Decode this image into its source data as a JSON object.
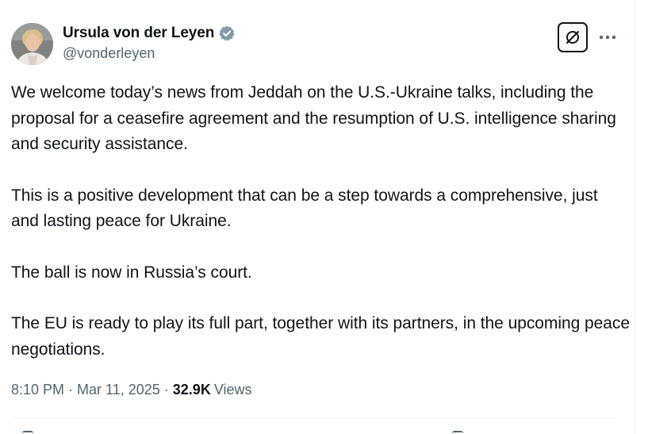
{
  "author": {
    "display_name": "Ursula von der Leyen",
    "handle": "@vonderleyen",
    "verified": true,
    "verified_color": "#829aab"
  },
  "actions": {
    "grok_icon": "grok-icon",
    "more_icon": "more-dots-icon"
  },
  "tweet": {
    "paragraphs": [
      "We welcome today’s news from Jeddah on the U.S.-Ukraine talks, including the proposal for a ceasefire agreement and the resumption of U.S. intelligence sharing and security assistance.",
      "This is a positive development that can be a step towards a comprehensive, just and lasting peace for Ukraine.",
      "The ball is now in Russia’s court.",
      "The EU is ready to play its full part, together with its partners, in the upcoming peace negotiations."
    ]
  },
  "meta": {
    "time": "8:10 PM",
    "separator": "·",
    "date": "Mar 11, 2025",
    "views_count": "32.9K",
    "views_label": "Views"
  },
  "colors": {
    "text": "#0f1419",
    "secondary_text": "#536471",
    "divider": "#eff3f4"
  }
}
